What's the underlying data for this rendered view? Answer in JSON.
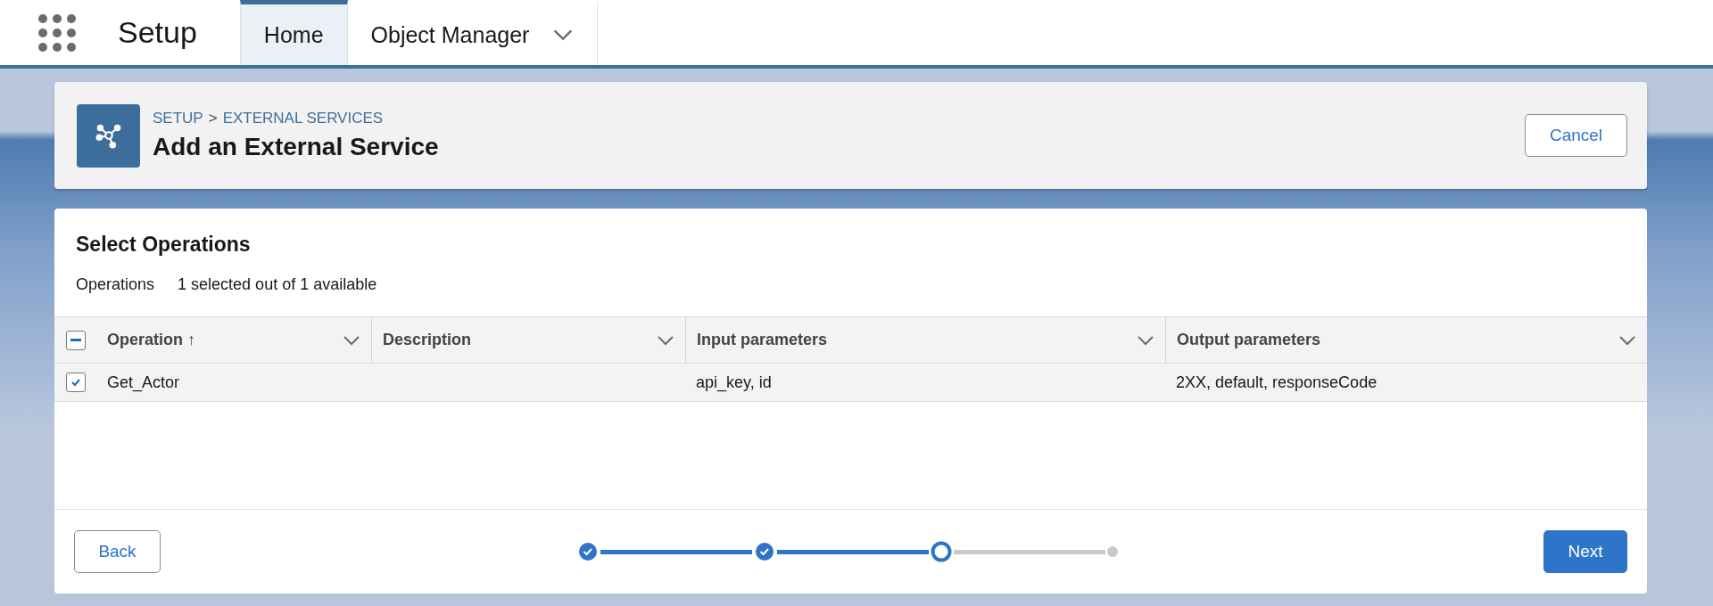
{
  "nav": {
    "app_name": "Setup",
    "tabs": [
      {
        "label": "Home",
        "selected": true,
        "has_menu": false
      },
      {
        "label": "Object Manager",
        "selected": false,
        "has_menu": true
      }
    ]
  },
  "header": {
    "breadcrumb": [
      {
        "label": "SETUP"
      },
      {
        "label": "EXTERNAL SERVICES"
      }
    ],
    "separator": ">",
    "title": "Add an External Service",
    "cancel_button": "Cancel"
  },
  "section": {
    "title": "Select Operations",
    "summary_label": "Operations",
    "summary_value": "1 selected out of 1 available"
  },
  "table": {
    "select_all_partial": true,
    "columns": [
      {
        "label": "Operation",
        "sort": "↑"
      },
      {
        "label": "Description"
      },
      {
        "label": "Input parameters"
      },
      {
        "label": "Output parameters"
      }
    ],
    "rows": [
      {
        "checked": true,
        "cells": [
          "Get_Actor",
          "",
          "api_key, id",
          "2XX, default, responseCode"
        ]
      }
    ]
  },
  "footer": {
    "back_button": "Back",
    "next_button": "Next",
    "steps": [
      {
        "complete": true,
        "current": false
      },
      {
        "complete": true,
        "current": false
      },
      {
        "complete": false,
        "current": true
      },
      {
        "complete": false,
        "current": false
      }
    ]
  }
}
